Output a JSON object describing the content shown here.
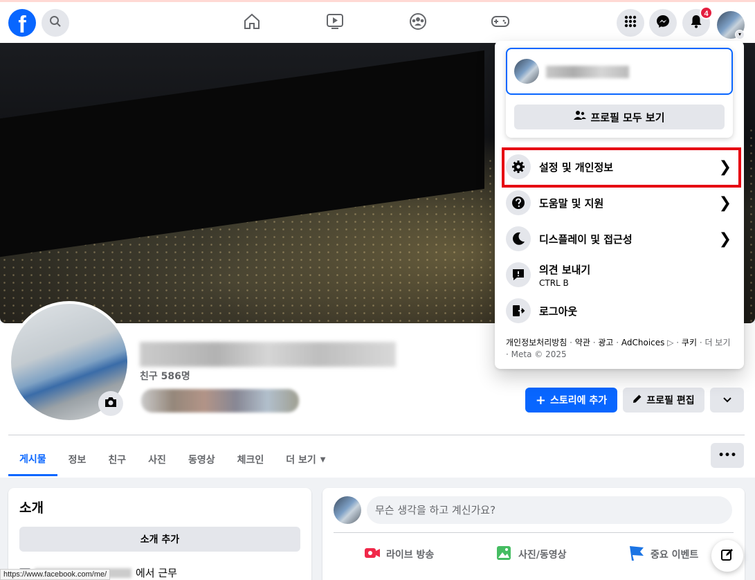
{
  "topbar": {
    "logo": "f",
    "notification_count": "4",
    "icons": [
      "search-icon",
      "home-icon",
      "video-icon",
      "groups-icon",
      "gaming-icon",
      "menu-grid-icon",
      "messenger-icon",
      "bell-icon"
    ]
  },
  "profile": {
    "friends": "친구 586명",
    "actions": {
      "add_story": "스토리에 추가",
      "edit_profile": "프로필 편집"
    }
  },
  "tabs": [
    {
      "label": "게시물",
      "active": true
    },
    {
      "label": "정보"
    },
    {
      "label": "친구"
    },
    {
      "label": "사진"
    },
    {
      "label": "동영상"
    },
    {
      "label": "체크인"
    },
    {
      "label": "더 보기"
    }
  ],
  "intro": {
    "title": "소개",
    "add_button": "소개 추가",
    "work_suffix": "에서 근무"
  },
  "composer": {
    "placeholder": "무슨 생각을 하고 계신가요?",
    "actions": [
      "라이브 방송",
      "사진/동영상",
      "중요 이벤트"
    ]
  },
  "menu": {
    "see_all_profiles": "프로필 모두 보기",
    "items": [
      {
        "label": "설정 및 개인정보",
        "icon": "gear-icon",
        "chevron": "❯"
      },
      {
        "label": "도움말 및 지원",
        "icon": "help-icon",
        "chevron": "❯"
      },
      {
        "label": "디스플레이 및 접근성",
        "icon": "moon-icon",
        "chevron": "❯"
      },
      {
        "label": "의견 보내기",
        "sub": "CTRL B",
        "icon": "feedback-icon"
      },
      {
        "label": "로그아웃",
        "icon": "logout-icon"
      }
    ],
    "footer": {
      "links": [
        "개인정보처리방침",
        "약관",
        "광고",
        "AdChoices",
        "쿠키",
        "더 보기"
      ],
      "copyright": "Meta © 2025"
    }
  },
  "status_bar": {
    "url": "https://www.facebook.com/me/"
  },
  "colors": {
    "brand": "#0866ff",
    "highlight": "#e60012",
    "badge": "#e41e3f"
  }
}
